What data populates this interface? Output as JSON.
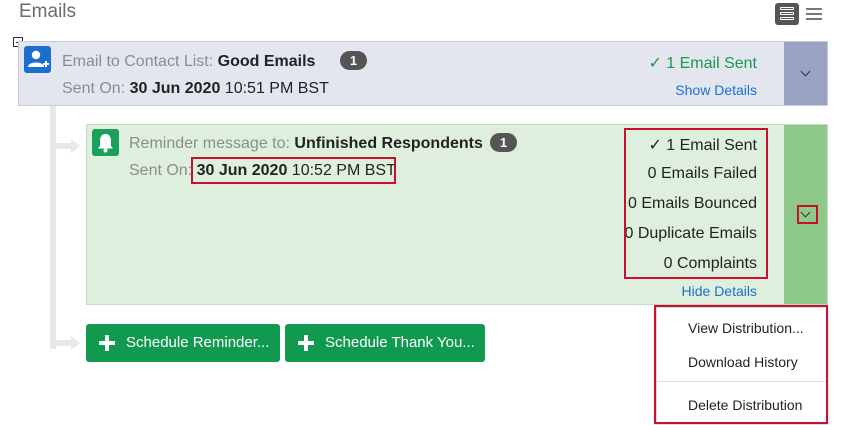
{
  "page": {
    "title": "Emails"
  },
  "distribution": {
    "label": "Email to Contact List:",
    "name": "Good Emails",
    "count": "1",
    "sent_on_label": "Sent On:",
    "sent_date": "30 Jun 2020",
    "sent_time": "10:51 PM BST",
    "status": "✓ 1 Email Sent",
    "details_link": "Show Details"
  },
  "reminder": {
    "label": "Reminder message to:",
    "name": "Unfinished Respondents",
    "count": "1",
    "sent_on_label": "Sent On:",
    "sent_date": "30 Jun 2020",
    "sent_time": "10:52 PM BST",
    "stats": {
      "sent": "✓ 1 Email Sent",
      "failed": "0 Emails Failed",
      "bounced": "0 Emails Bounced",
      "duplicate": "0 Duplicate Emails",
      "complaints": "0 Complaints"
    },
    "details_link": "Hide Details"
  },
  "actions": {
    "schedule_reminder": "Schedule Reminder...",
    "schedule_thank_you": "Schedule Thank You..."
  },
  "menu": {
    "items": [
      "View Distribution...",
      "Download History",
      "Delete Distribution"
    ]
  },
  "colors": {
    "accent_blue": "#1c6fcf",
    "accent_green": "#119a4f",
    "highlight": "#c8102e"
  }
}
